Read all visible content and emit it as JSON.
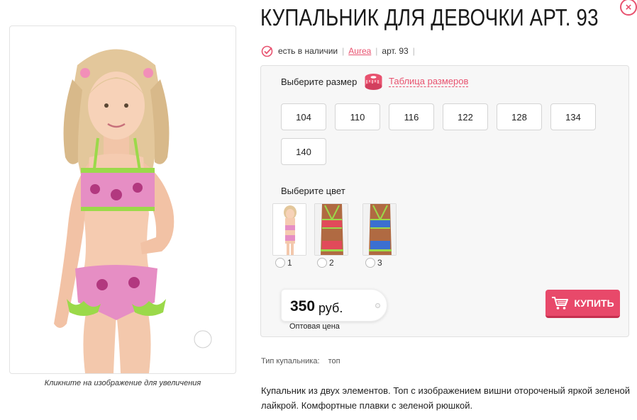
{
  "product": {
    "title": "КУПАЛЬНИК ДЛЯ ДЕВОЧКИ АРТ. 93",
    "availability": "есть в наличии",
    "brand": "Aurea",
    "article": "арт. 93"
  },
  "gallery": {
    "caption": "Кликните на изображение для увеличения"
  },
  "sizes": {
    "label": "Выберите размер",
    "chart_link": "Таблица размеров",
    "options": [
      "104",
      "110",
      "116",
      "122",
      "128",
      "134",
      "140"
    ]
  },
  "colors": {
    "label": "Выберите цвет",
    "options": [
      "1",
      "2",
      "3"
    ]
  },
  "price": {
    "amount": "350",
    "currency": "руб.",
    "note": "Оптовая цена"
  },
  "buy_button": {
    "label": "КУПИТЬ"
  },
  "attributes": {
    "label": "Тип купальника:",
    "value": "топ"
  },
  "description": "Купальник из двух элементов. Топ с изображением вишни отороченый яркой зеленой лайкрой. Комфортные плавки с зеленой рюшкой.",
  "theme": {
    "accent": "#e8526f",
    "buy": "#e8496a",
    "swimsuit_pink": "#e68ec4",
    "trim_green": "#9bd94a"
  },
  "icons": [
    "check-circle-icon",
    "measuring-tape-icon",
    "cart-icon",
    "magnifier-icon",
    "close-icon"
  ]
}
